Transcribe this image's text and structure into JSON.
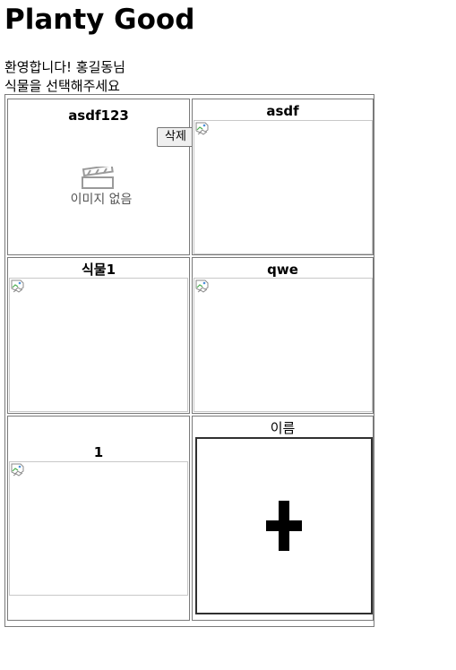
{
  "app": {
    "title": "Planty Good"
  },
  "greeting": {
    "welcome": "환영합니다! 홍길동님",
    "prompt": "식물을 선택해주세요"
  },
  "plants": [
    {
      "name": "asdf123",
      "image": "no-image-placeholder",
      "no_image_text": "이미지 없음",
      "delete_label": "삭제"
    },
    {
      "name": "asdf",
      "image": "broken-image-icon"
    },
    {
      "name": "식물1",
      "image": "broken-image-icon"
    },
    {
      "name": "qwe",
      "image": "broken-image-icon"
    },
    {
      "name": "1",
      "image": "broken-image-icon"
    }
  ],
  "add_cell": {
    "name": "이름",
    "icon": "plus-icon"
  }
}
